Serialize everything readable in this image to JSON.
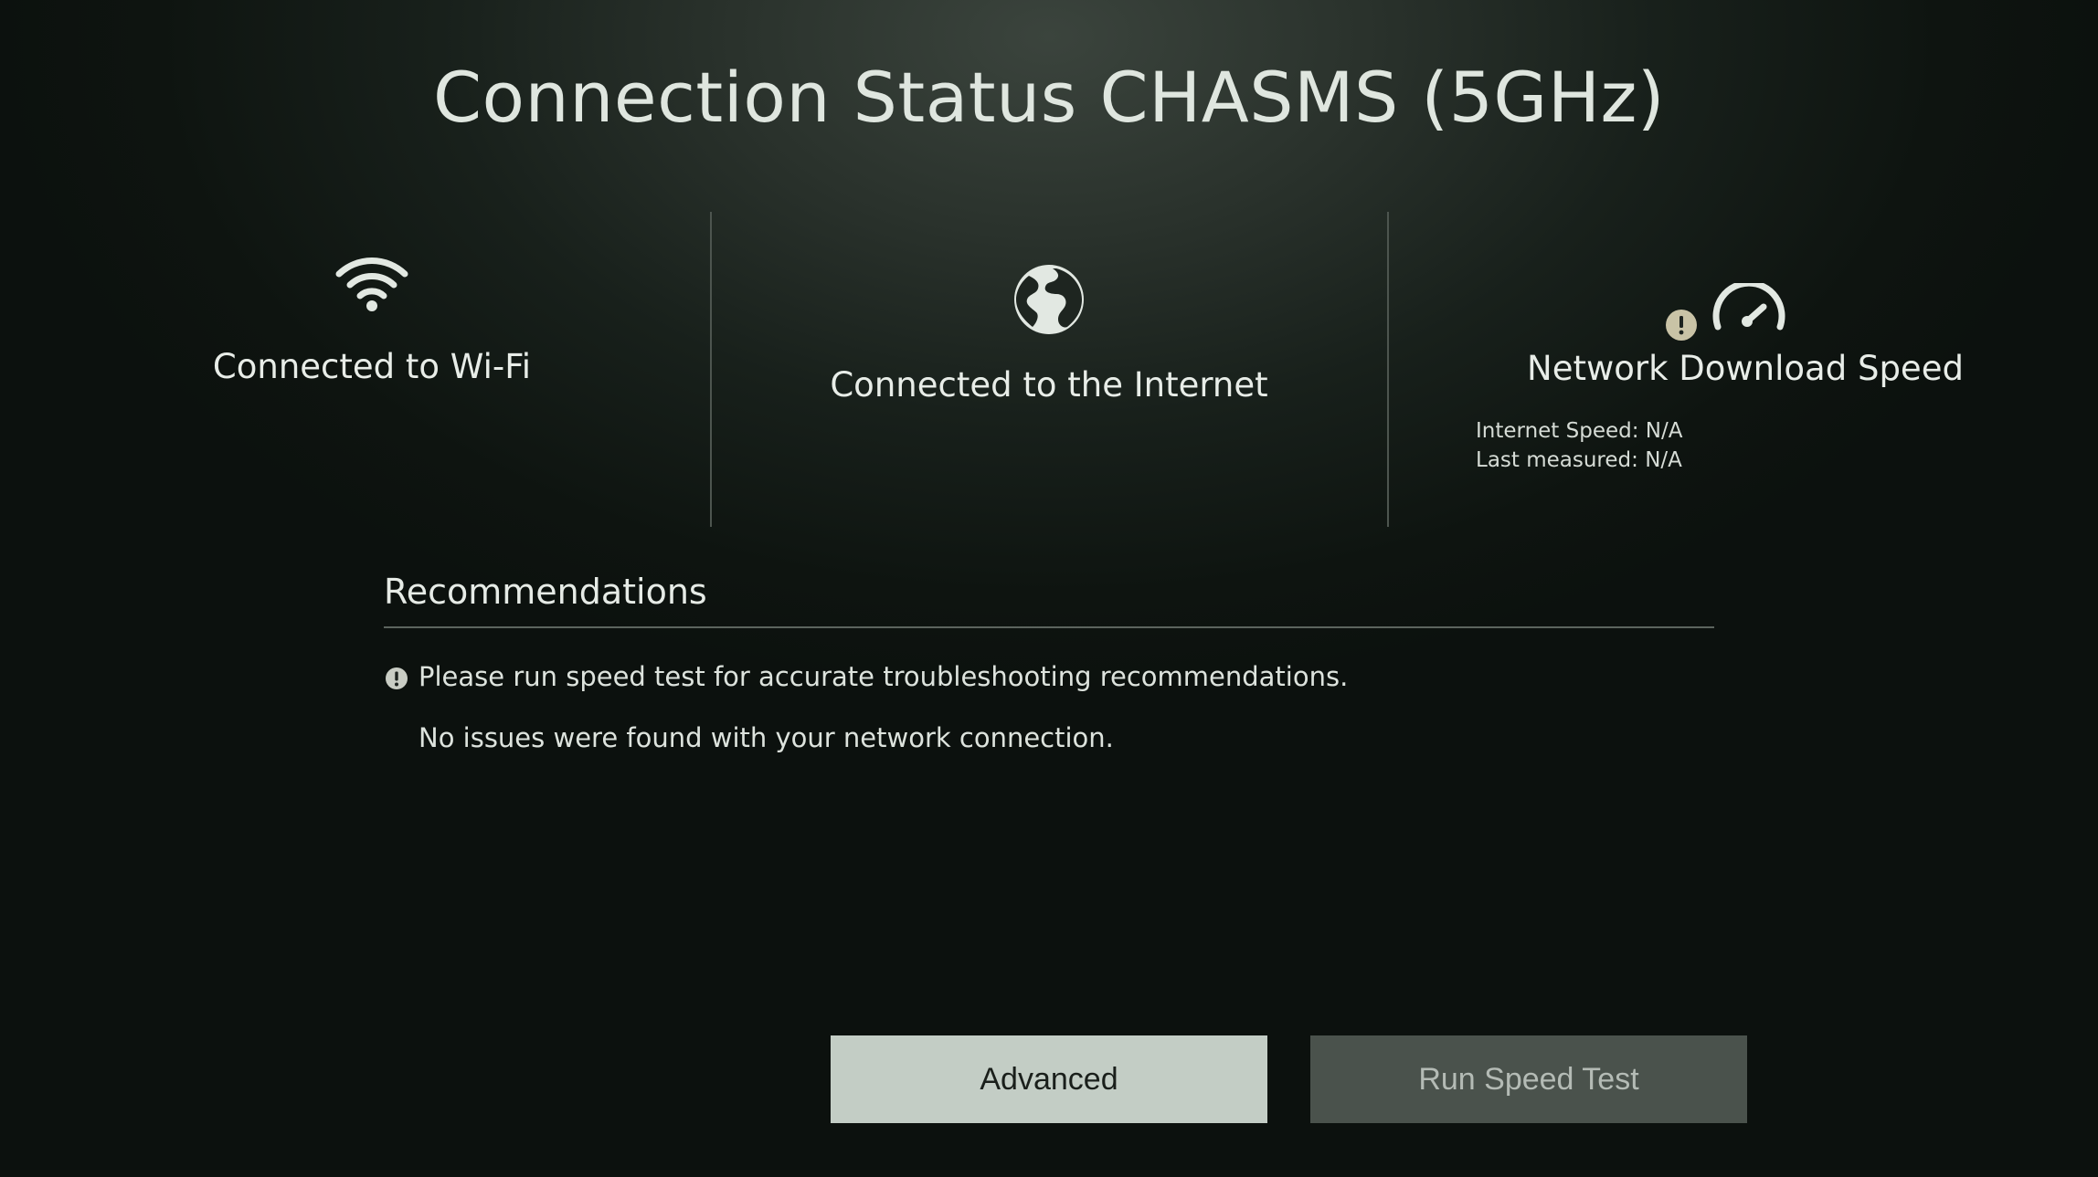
{
  "header": {
    "title": "Connection Status CHASMS (5GHz)"
  },
  "status": {
    "wifi": {
      "label": "Connected to Wi-Fi",
      "icon": "wifi-icon"
    },
    "internet": {
      "label": "Connected to the Internet",
      "icon": "globe-icon"
    },
    "download": {
      "label": "Network Download Speed",
      "icon": "speedometer-icon",
      "warning_icon": "warning-icon",
      "internet_speed": "Internet Speed: N/A",
      "last_measured": "Last measured: N/A"
    }
  },
  "recommendations": {
    "title": "Recommendations",
    "items": [
      "Please run speed test for accurate troubleshooting recommendations.",
      "No issues were found with your network connection."
    ]
  },
  "buttons": {
    "advanced": "Advanced",
    "run_speed_test": "Run Speed Test"
  },
  "colors": {
    "focused_button": "#c3cdc5",
    "unfocused_button": "#4a524c",
    "warning": "#c9c3a6"
  }
}
